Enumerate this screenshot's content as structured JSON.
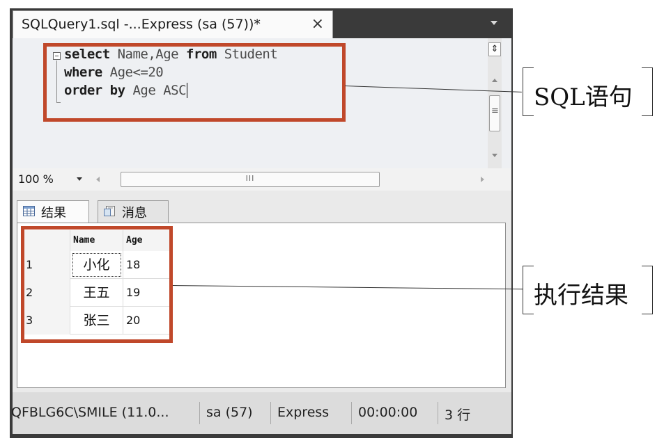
{
  "tab": {
    "title": "SQLQuery1.sql -...Express (sa (57))*",
    "close_glyph": "×"
  },
  "editor": {
    "lines": [
      {
        "parts": [
          "select",
          " Name,Age ",
          "from",
          " Student"
        ]
      },
      {
        "parts": [
          "where",
          " Age<=20"
        ]
      },
      {
        "parts": [
          "order by",
          " Age ASC"
        ]
      }
    ],
    "split_glyph": "⇕"
  },
  "zoom": {
    "value": "100 %",
    "hscroll_grip": "III"
  },
  "results": {
    "tabs": [
      {
        "label": "结果",
        "icon": "grid-icon"
      },
      {
        "label": "消息",
        "icon": "messages-icon"
      }
    ],
    "columns": [
      "Name",
      "Age"
    ],
    "rows": [
      {
        "num": "1",
        "name": "小化",
        "age": "18"
      },
      {
        "num": "2",
        "name": "王五",
        "age": "19"
      },
      {
        "num": "3",
        "name": "张三",
        "age": "20"
      }
    ]
  },
  "status": {
    "server": "QFBLG6C\\SMILE (11.0...",
    "user": "sa (57)",
    "edition": "Express",
    "elapsed": "00:00:00",
    "rows": "3 行"
  },
  "annotations": {
    "sql_label": "SQL语句",
    "result_label": "执行结果"
  },
  "colors": {
    "highlight": "#c0482a",
    "editor_bg": "#eef0f3",
    "window_frame": "#3a3a3a"
  }
}
